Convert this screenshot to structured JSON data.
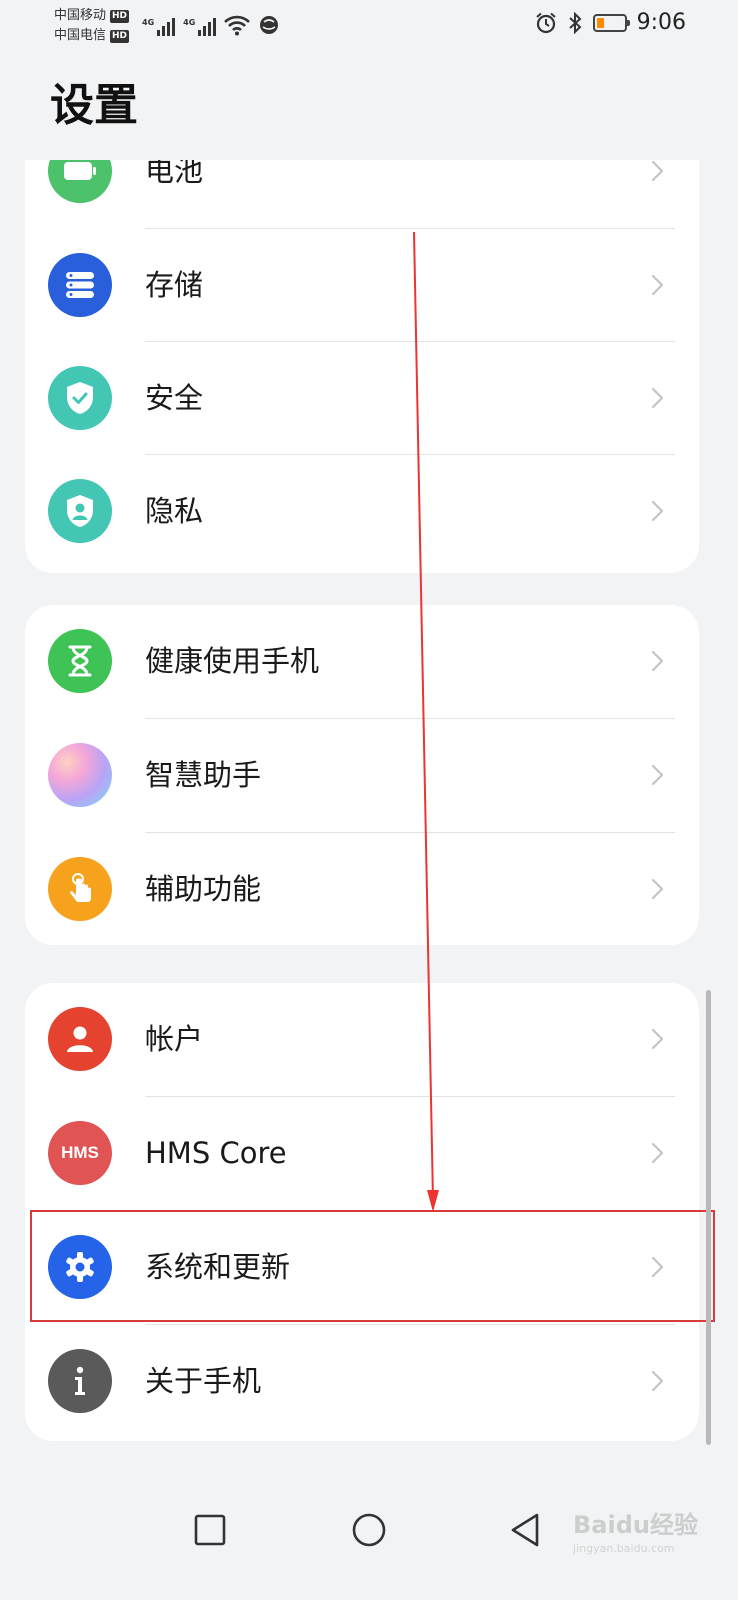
{
  "status_bar": {
    "carrier1": "中国移动",
    "carrier2": "中国电信",
    "hd_badge": "HD",
    "network_label": "4G",
    "time": "9:06",
    "battery_level": 0.25
  },
  "page_title": "设置",
  "groups": [
    {
      "items": [
        {
          "label": "电池",
          "icon": "battery-icon",
          "color": "#4cc26a"
        },
        {
          "label": "存储",
          "icon": "storage-icon",
          "color": "#2a5fdc"
        },
        {
          "label": "安全",
          "icon": "shield-check-icon",
          "color": "#43c6b4"
        },
        {
          "label": "隐私",
          "icon": "privacy-shield-icon",
          "color": "#43c6b4"
        }
      ]
    },
    {
      "items": [
        {
          "label": "健康使用手机",
          "icon": "hourglass-icon",
          "color": "#3fc256"
        },
        {
          "label": "智慧助手",
          "icon": "assistant-orb-icon",
          "color": "#c7a6f0"
        },
        {
          "label": "辅助功能",
          "icon": "hand-touch-icon",
          "color": "#f6a21c"
        }
      ]
    },
    {
      "items": [
        {
          "label": "帐户",
          "icon": "user-icon",
          "color": "#e5432f"
        },
        {
          "label": "HMS Core",
          "icon": "hms-icon",
          "icon_text": "HMS",
          "color": "#e05454"
        },
        {
          "label": "系统和更新",
          "icon": "gear-icon",
          "color": "#2563e8"
        },
        {
          "label": "关于手机",
          "icon": "info-icon",
          "color": "#5a5a5a"
        }
      ]
    }
  ],
  "watermark": {
    "text": "Baidu经验",
    "sub": "jingyan.baidu.com"
  }
}
